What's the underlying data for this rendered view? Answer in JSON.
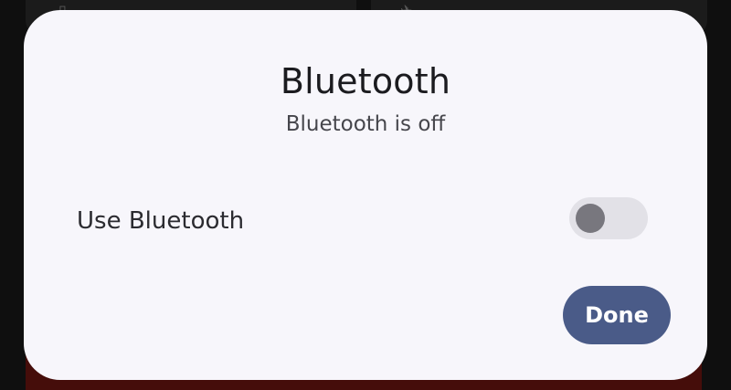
{
  "dialog": {
    "title": "Bluetooth",
    "status": "Bluetooth is off",
    "toggle": {
      "label": "Use Bluetooth",
      "state": "off"
    },
    "done_label": "Done"
  },
  "colors": {
    "dialog_bg": "#f7f6fb",
    "primary_button": "#4a5b88",
    "switch_track_off": "#e2e1e7",
    "switch_thumb_off": "#78777e"
  }
}
